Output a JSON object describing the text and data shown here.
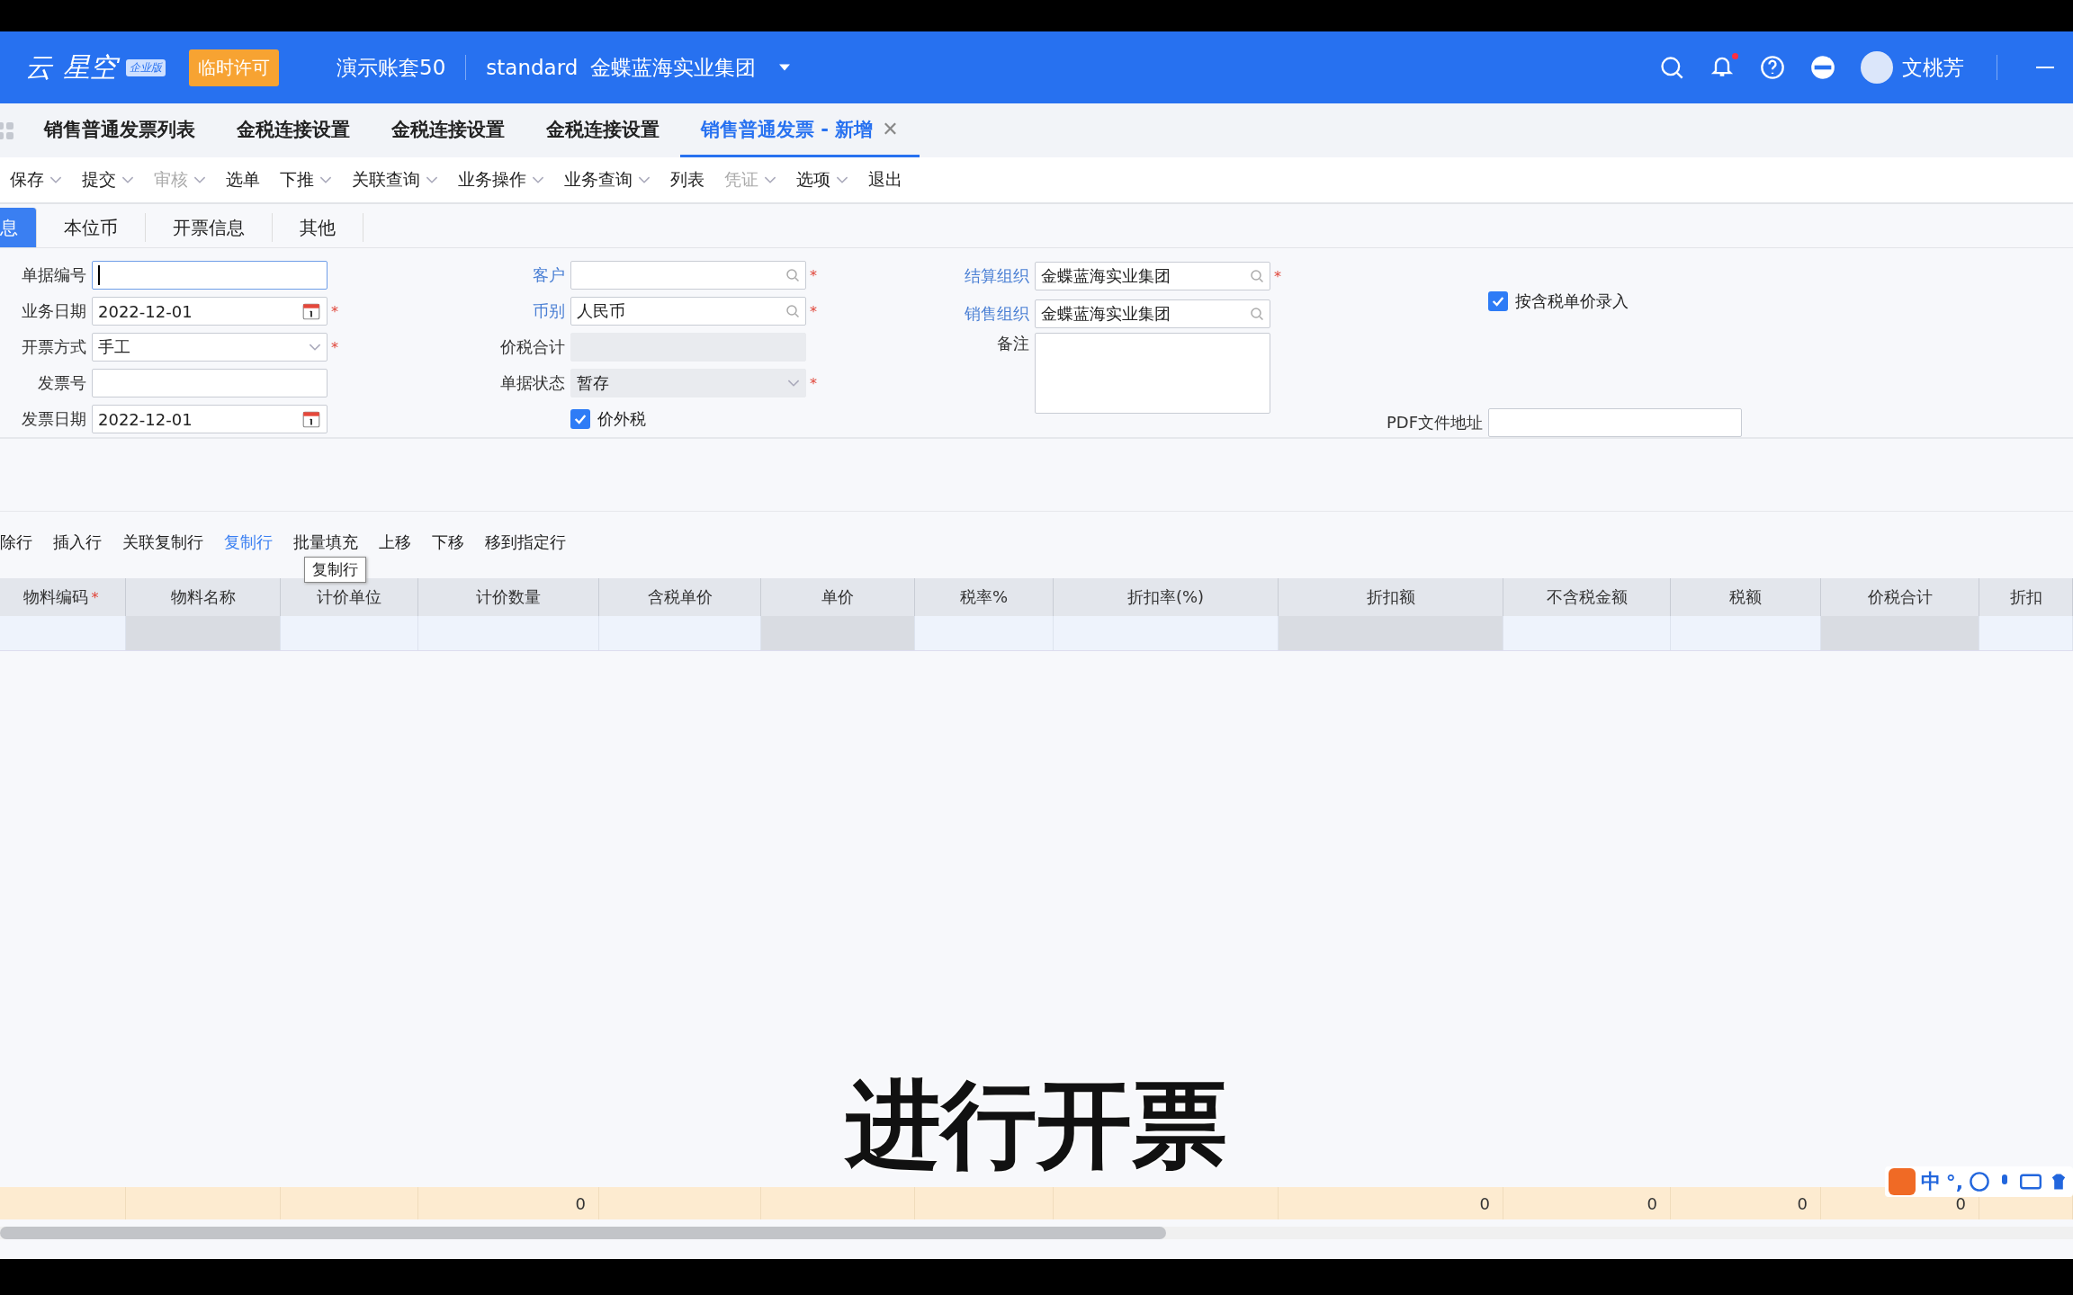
{
  "header": {
    "logo": "云",
    "logo_2": "星空",
    "edition_badge": "企业版",
    "license_badge": "临时许可",
    "account": "演示账套50",
    "scheme": "standard",
    "org": "金蝶蓝海实业集团",
    "user": "文桃芳",
    "unread": true
  },
  "tabs": [
    {
      "label": "销售普通发票列表",
      "selected": false
    },
    {
      "label": "金税连接设置",
      "selected": false
    },
    {
      "label": "金税连接设置",
      "selected": false
    },
    {
      "label": "金税连接设置",
      "selected": false
    },
    {
      "label": "销售普通发票 - 新增",
      "selected": true,
      "close": "✕"
    }
  ],
  "toolbar": [
    {
      "label": "保存",
      "disabled": false,
      "dropdown": true
    },
    {
      "label": "提交",
      "disabled": false,
      "dropdown": true
    },
    {
      "label": "审核",
      "disabled": true,
      "dropdown": true
    },
    {
      "label": "选单",
      "disabled": false,
      "dropdown": false
    },
    {
      "label": "下推",
      "disabled": false,
      "dropdown": true
    },
    {
      "label": "关联查询",
      "disabled": false,
      "dropdown": true
    },
    {
      "label": "业务操作",
      "disabled": false,
      "dropdown": true
    },
    {
      "label": "业务查询",
      "disabled": false,
      "dropdown": true
    },
    {
      "label": "列表",
      "disabled": false,
      "dropdown": false
    },
    {
      "label": "凭证",
      "disabled": true,
      "dropdown": true
    },
    {
      "label": "选项",
      "disabled": false,
      "dropdown": true
    },
    {
      "label": "退出",
      "disabled": false,
      "dropdown": false
    }
  ],
  "sub_tabs": [
    {
      "label": "息",
      "selected": true
    },
    {
      "label": "本位币",
      "selected": false
    },
    {
      "label": "开票信息",
      "selected": false
    },
    {
      "label": "其他",
      "selected": false
    }
  ],
  "form_columns": [
    [
      {
        "kind": "text",
        "label": "单据编号",
        "link": false,
        "focused": true
      },
      {
        "kind": "date",
        "label": "业务日期",
        "value": "2022-12-01",
        "link": false,
        "asterisk": "*"
      },
      {
        "kind": "select",
        "label": "开票方式",
        "value": "手工",
        "link": false,
        "asterisk": "*"
      },
      {
        "kind": "text",
        "label": "发票号",
        "link": false,
        "focused": false
      },
      {
        "kind": "date",
        "label": "发票日期",
        "value": "2022-12-01",
        "link": false
      }
    ],
    [
      {
        "kind": "lookup",
        "label": "客户",
        "link": true,
        "asterisk": "*"
      },
      {
        "kind": "lookup",
        "label": "币别",
        "value": "人民币",
        "link": true,
        "asterisk": "*"
      },
      {
        "kind": "readonly",
        "label": "价税合计",
        "link": false
      },
      {
        "kind": "select_readonly",
        "label": "单据状态",
        "value": "暂存",
        "link": false,
        "asterisk": "*"
      },
      {
        "kind": "checkbox",
        "label": "价外税",
        "checked": true
      }
    ],
    [
      {
        "kind": "lookup",
        "label": "结算组织",
        "value": "金蝶蓝海实业集团",
        "link": true,
        "asterisk": "*"
      },
      {
        "kind": "lookup",
        "label": "销售组织",
        "value": "金蝶蓝海实业集团",
        "link": true
      },
      {
        "kind": "textarea",
        "label": "备注",
        "link": false
      }
    ],
    [
      {
        "kind": "spacer"
      },
      {
        "kind": "checkbox",
        "label": "按含税单价录入",
        "checked": true
      },
      {
        "kind": "spacer"
      },
      {
        "kind": "spacer"
      },
      {
        "kind": "text",
        "label": "PDF文件地址",
        "link": false,
        "focused": false
      }
    ]
  ],
  "grid_toolbar": [
    {
      "label": "除行",
      "hovered": false
    },
    {
      "label": "插入行",
      "hovered": false
    },
    {
      "label": "关联复制行",
      "hovered": false
    },
    {
      "label": "复制行",
      "hovered": true
    },
    {
      "label": "批量填充",
      "hovered": false
    },
    {
      "label": "上移",
      "hovered": false
    },
    {
      "label": "下移",
      "hovered": false
    },
    {
      "label": "移到指定行",
      "hovered": false
    }
  ],
  "tooltip": "复制行",
  "grid": {
    "columns": [
      {
        "label": "物料编码",
        "asterisk": "*",
        "locked": false
      },
      {
        "label": "物料名称",
        "locked": true
      },
      {
        "label": "计价单位",
        "locked": false
      },
      {
        "label": "计价数量",
        "locked": false,
        "total": "0"
      },
      {
        "label": "含税单价",
        "locked": false
      },
      {
        "label": "单价",
        "locked": true
      },
      {
        "label": "税率%",
        "locked": false
      },
      {
        "label": "折扣率(%)",
        "locked": false
      },
      {
        "label": "折扣额",
        "locked": true,
        "total": "0"
      },
      {
        "label": "不含税金额",
        "locked": false,
        "total": "0"
      },
      {
        "label": "税额",
        "locked": false,
        "total": "0"
      },
      {
        "label": "价税合计",
        "locked": true,
        "total": "0"
      },
      {
        "label": "折扣",
        "locked": false
      }
    ]
  },
  "subtitle": "进行开票",
  "ime_toolbar": {
    "mode": "中",
    "punct": "°,"
  }
}
